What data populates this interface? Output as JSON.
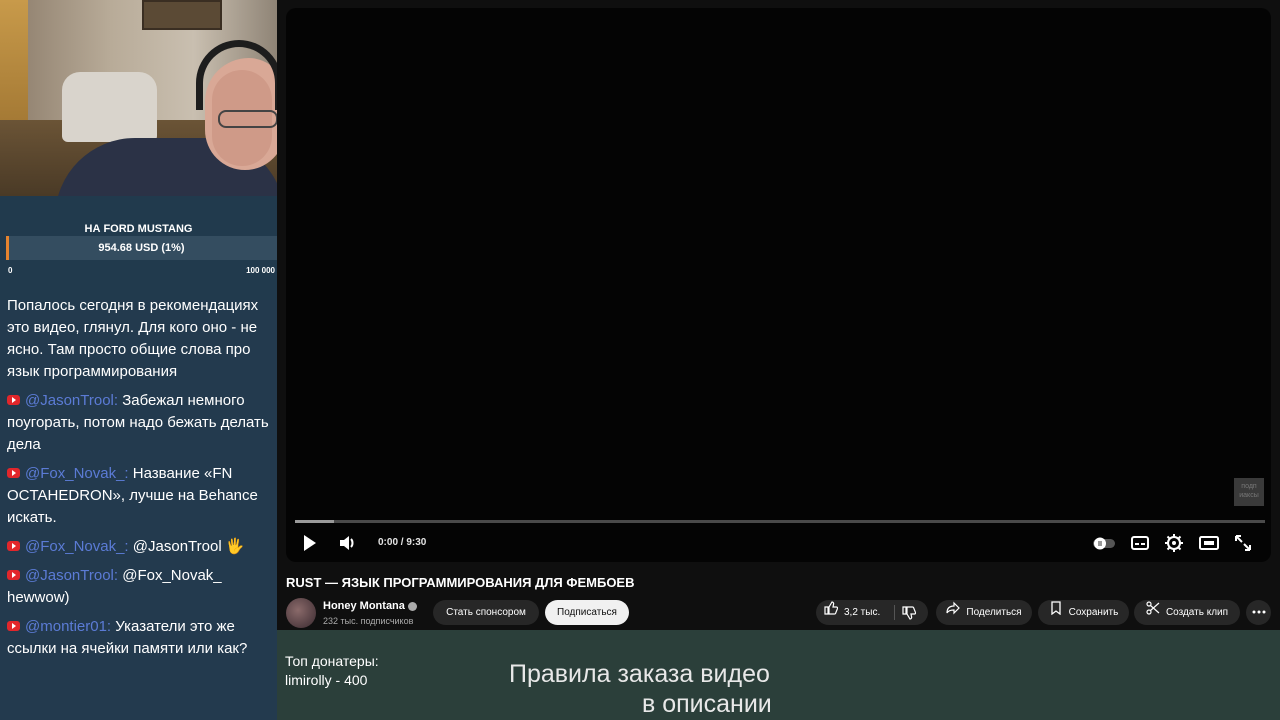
{
  "goal": {
    "title": "НА FORD MUSTANG",
    "amount": "954.68 USD (1%)",
    "progress_fraction": 0.01,
    "min": "0",
    "max": "100 000"
  },
  "chat": [
    {
      "author": "",
      "text": "Попалось сегодня в рекомендациях это видео, глянул. Для кого оно - не ясно. Там просто общие слова про язык программирования"
    },
    {
      "author": "@JasonTrool:",
      "text": " Забежал немного поугорать, потом надо бежать делать дела"
    },
    {
      "author": "@Fox_Novak_:",
      "text": " Название «FN OCTAHEDRON», лучше на Behance искать."
    },
    {
      "author": "@Fox_Novak_:",
      "text": " @JasonTrool 🖐"
    },
    {
      "author": "@JasonTrool:",
      "text": " @Fox_Novak_ hewwow)"
    },
    {
      "author": "@montier01:",
      "text": " Указатели это же ссылки на ячейки памяти или как?"
    }
  ],
  "player": {
    "time": "0:00 / 9:30",
    "progress_fraction": 0.04,
    "corner_tag": "подп иаксы"
  },
  "video": {
    "title": "RUST — ЯЗЫК ПРОГРАММИРОВАНИЯ ДЛЯ ФЕМБОЕВ",
    "channel": "Honey Montana",
    "subscribers": "232 тыс. подписчиков",
    "sponsor_label": "Стать спонсором",
    "subscribe_label": "Подписаться",
    "likes": "3,2 тыс.",
    "share_label": "Поделиться",
    "save_label": "Сохранить",
    "clip_label": "Создать клип"
  },
  "overlay": {
    "top_donors_label": "Топ донатеры:",
    "top_donor": "limirolly - 400",
    "rules_line1": "Правила заказа видео",
    "rules_line2": "в описании"
  },
  "colors": {
    "goal_fill": "#e6842f",
    "chat_bg": "#233a4e",
    "author": "#5b7bd5",
    "bottom_band": "#2b3f3a"
  }
}
